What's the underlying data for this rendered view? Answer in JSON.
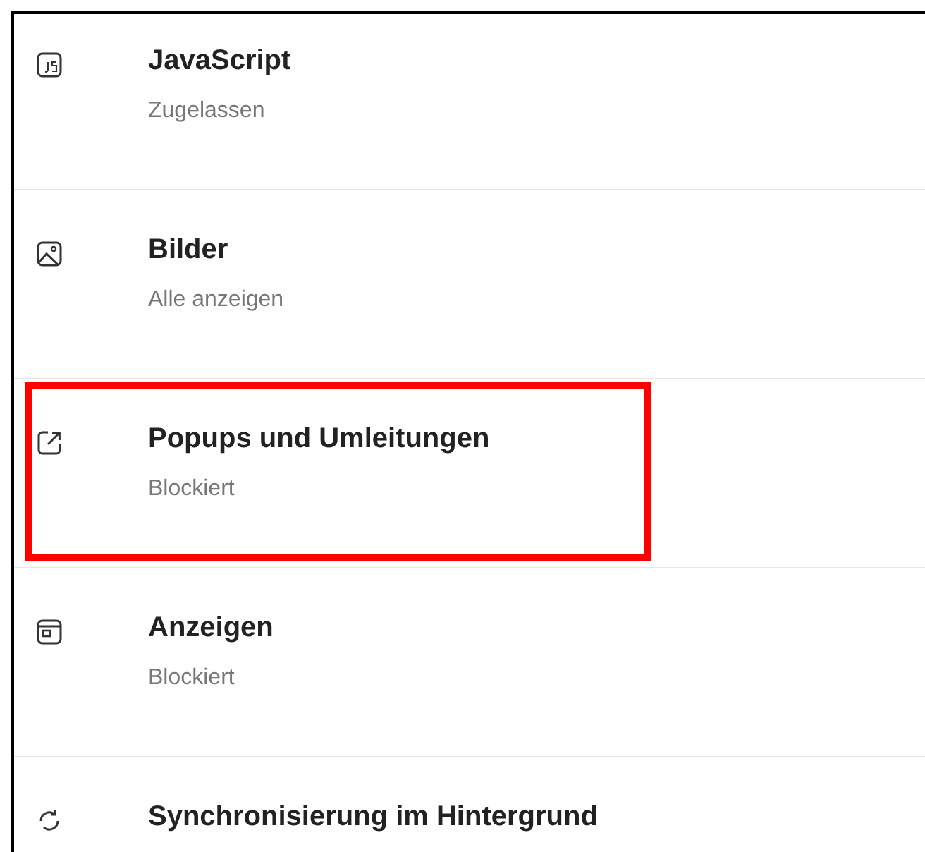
{
  "settings_list": [
    {
      "kind": "javascript",
      "title": "JavaScript",
      "status": "Zugelassen",
      "highlighted": false
    },
    {
      "kind": "image",
      "title": "Bilder",
      "status": "Alle anzeigen",
      "highlighted": false
    },
    {
      "kind": "popup",
      "title": "Popups und Umleitungen",
      "status": "Blockiert",
      "highlighted": true
    },
    {
      "kind": "ads",
      "title": "Anzeigen",
      "status": "Blockiert",
      "highlighted": false
    },
    {
      "kind": "sync",
      "title": "Synchronisierung im Hintergrund",
      "highlighted": false
    }
  ]
}
